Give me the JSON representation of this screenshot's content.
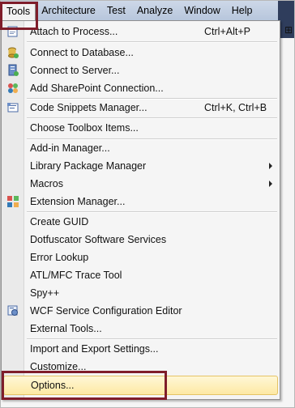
{
  "menubar": {
    "items": [
      "Tools",
      "Architecture",
      "Test",
      "Analyze",
      "Window",
      "Help"
    ]
  },
  "menu": {
    "items": [
      {
        "label": "Attach to Process...",
        "shortcut": "Ctrl+Alt+P",
        "icon": "attach-process-icon"
      },
      {
        "label": "Connect to Database...",
        "shortcut": "",
        "icon": "database-icon"
      },
      {
        "label": "Connect to Server...",
        "shortcut": "",
        "icon": "server-icon"
      },
      {
        "label": "Add SharePoint Connection...",
        "shortcut": "",
        "icon": "sharepoint-icon"
      },
      {
        "label": "Code Snippets Manager...",
        "shortcut": "Ctrl+K, Ctrl+B",
        "icon": "snippets-icon"
      },
      {
        "label": "Choose Toolbox Items...",
        "shortcut": ""
      },
      {
        "label": "Add-in Manager...",
        "shortcut": ""
      },
      {
        "label": "Library Package Manager",
        "shortcut": "",
        "submenu": true
      },
      {
        "label": "Macros",
        "shortcut": "",
        "submenu": true
      },
      {
        "label": "Extension Manager...",
        "shortcut": "",
        "icon": "extension-icon"
      },
      {
        "label": "Create GUID",
        "shortcut": ""
      },
      {
        "label": "Dotfuscator Software Services",
        "shortcut": ""
      },
      {
        "label": "Error Lookup",
        "shortcut": ""
      },
      {
        "label": "ATL/MFC Trace Tool",
        "shortcut": ""
      },
      {
        "label": "Spy++",
        "shortcut": ""
      },
      {
        "label": "WCF Service Configuration Editor",
        "shortcut": "",
        "icon": "wcf-icon"
      },
      {
        "label": "External Tools...",
        "shortcut": ""
      },
      {
        "label": "Import and Export Settings...",
        "shortcut": ""
      },
      {
        "label": "Customize...",
        "shortcut": ""
      },
      {
        "label": "Options...",
        "shortcut": ""
      }
    ]
  },
  "colors": {
    "highlight_box": "#7f1d2a",
    "hover_fill": "#fde9a4"
  }
}
